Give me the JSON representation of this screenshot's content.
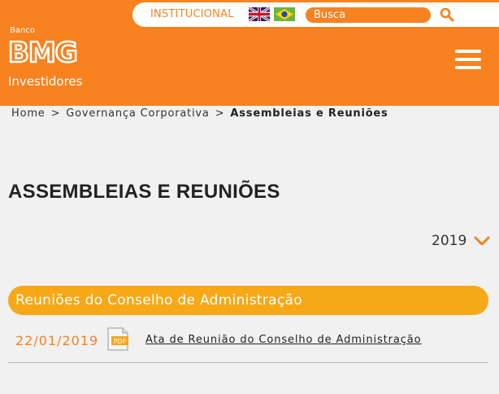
{
  "header": {
    "institutional_label": "INSTITUCIONAL",
    "search_placeholder": "Busca",
    "logo": {
      "banco": "Banco",
      "brand": "BMG",
      "subtitle": "Investidores"
    },
    "icons": [
      "flag-uk-icon",
      "flag-br-icon",
      "search-icon",
      "hamburger-menu-icon"
    ],
    "colors": {
      "brand_orange": "#f7821f",
      "section_orange": "#f7a816"
    }
  },
  "breadcrumb": {
    "items": [
      "Home",
      "Governança Corporativa",
      "Assembleias e Reuniões"
    ],
    "separator": ">"
  },
  "page": {
    "title": "ASSEMBLEIAS E REUNIÕES",
    "year_selected": "2019"
  },
  "section": {
    "title": "Reuniões do Conselho de Administração",
    "rows": [
      {
        "date": "22/01/2019",
        "file_type": "PDF",
        "link_text": "Ata de Reunião do Conselho de Administração"
      }
    ]
  }
}
